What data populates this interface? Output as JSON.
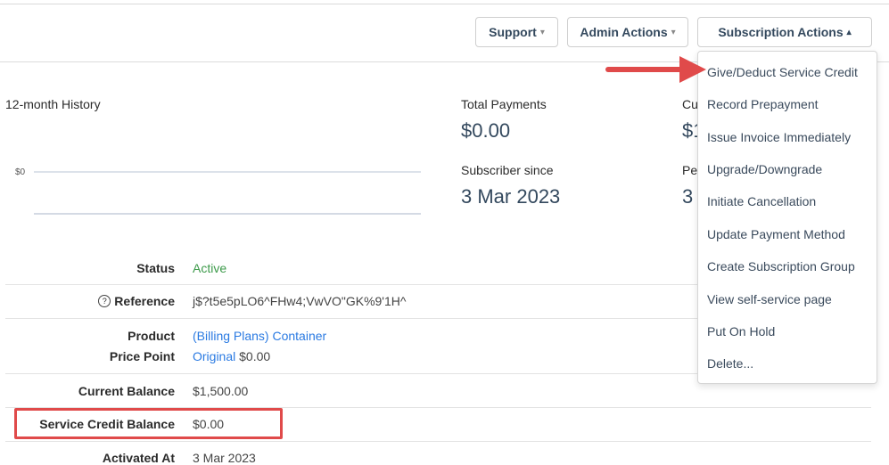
{
  "toolbar": {
    "support_label": "Support",
    "admin_label": "Admin Actions",
    "subscription_label": "Subscription Actions"
  },
  "dropdown": {
    "items": [
      "Give/Deduct Service Credit",
      "Record Prepayment",
      "Issue Invoice Immediately",
      "Upgrade/Downgrade",
      "Initiate Cancellation",
      "Update Payment Method",
      "Create Subscription Group",
      "View self-service page",
      "Put On Hold",
      "Delete..."
    ]
  },
  "history": {
    "title": "12-month History",
    "axis_label": "$0"
  },
  "stats": {
    "total_payments_label": "Total Payments",
    "total_payments_value": "$0.00",
    "subscriber_since_label": "Subscriber since",
    "subscriber_since_value": "3 Mar 2023",
    "col3_label_partial": "Cu",
    "col3_value_partial": "$1",
    "col4_label_partial": "Pe",
    "col4_value_partial": "3"
  },
  "details": {
    "status_label": "Status",
    "status_value": "Active",
    "reference_label": "Reference",
    "reference_value": "j$?t5e5pLO6^FHw4;VwVO\"GK%9'1H^",
    "product_label": "Product",
    "product_value": "(Billing Plans) Container",
    "price_point_label": "Price Point",
    "price_point_link": "Original",
    "price_point_amount": "$0.00",
    "current_balance_label": "Current Balance",
    "current_balance_value": "$1,500.00",
    "service_credit_label": "Service Credit Balance",
    "service_credit_value": "$0.00",
    "activated_label": "Activated At",
    "activated_value": "3 Mar 2023"
  },
  "colors": {
    "annotation_red": "#e04a4a",
    "link_blue": "#2a7ae2",
    "status_green": "#3c9a4a"
  }
}
